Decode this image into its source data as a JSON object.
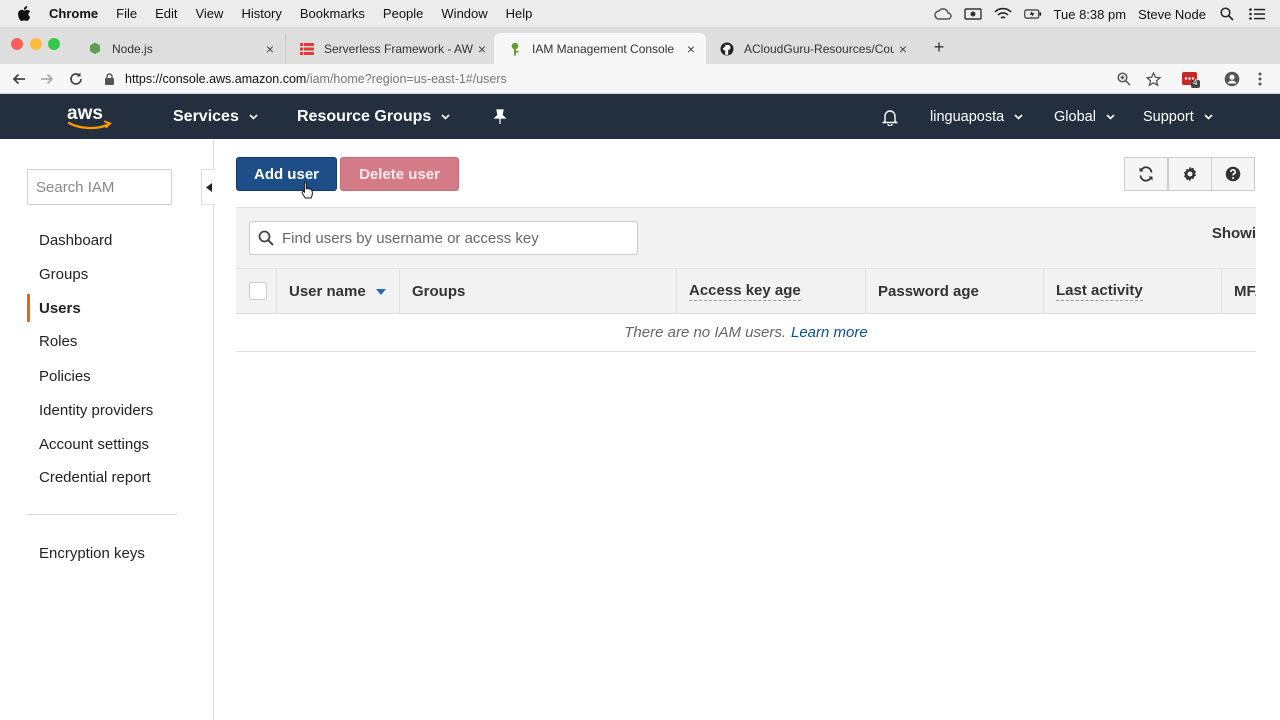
{
  "menubar": {
    "app": "Chrome",
    "items": [
      "File",
      "Edit",
      "View",
      "History",
      "Bookmarks",
      "People",
      "Window",
      "Help"
    ],
    "clock": "Tue 8:38 pm",
    "user": "Steve Node"
  },
  "tabs": [
    {
      "title": "Node.js",
      "icon": "nodejs-icon"
    },
    {
      "title": "Serverless Framework - AWS L",
      "icon": "serverless-icon"
    },
    {
      "title": "IAM Management Console",
      "icon": "aws-iam-icon"
    },
    {
      "title": "ACloudGuru-Resources/Course",
      "icon": "github-icon"
    }
  ],
  "address": {
    "host": "https://console.aws.amazon.com",
    "path": "/iam/home?region=us-east-1#/users"
  },
  "extension_badge": "4",
  "aws": {
    "logo_text": "aws",
    "services": "Services",
    "resource_groups": "Resource Groups",
    "account": "linguaposta",
    "region": "Global",
    "support": "Support"
  },
  "sidebar": {
    "search_placeholder": "Search IAM",
    "items": [
      {
        "label": "Dashboard"
      },
      {
        "label": "Groups"
      },
      {
        "label": "Users"
      },
      {
        "label": "Roles"
      },
      {
        "label": "Policies"
      },
      {
        "label": "Identity providers"
      },
      {
        "label": "Account settings"
      },
      {
        "label": "Credential report"
      }
    ],
    "bottom_item": "Encryption keys"
  },
  "toolbar": {
    "add_user": "Add user",
    "delete_user": "Delete user"
  },
  "table": {
    "search_placeholder": "Find users by username or access key",
    "showing": "Showi",
    "columns": [
      "User name",
      "Groups",
      "Access key age",
      "Password age",
      "Last activity",
      "MFA"
    ],
    "empty_message": "There are no IAM users.",
    "learn_more": "Learn more"
  },
  "colors": {
    "aws_nav": "#232f3e",
    "primary_button": "#1e4e87",
    "delete_button": "#d37c87",
    "active_accent": "#dd6b10",
    "link": "#0d4f8b"
  }
}
